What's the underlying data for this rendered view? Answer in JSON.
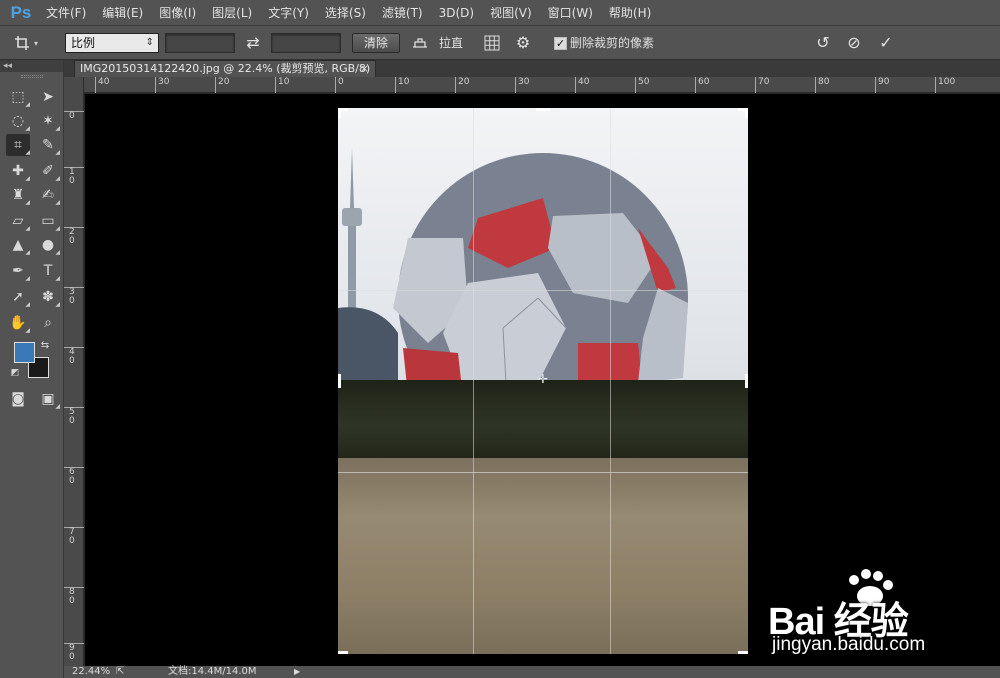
{
  "app": {
    "logo": "Ps"
  },
  "menu": [
    "文件(F)",
    "编辑(E)",
    "图像(I)",
    "图层(L)",
    "文字(Y)",
    "选择(S)",
    "滤镜(T)",
    "3D(D)",
    "视图(V)",
    "窗口(W)",
    "帮助(H)"
  ],
  "options": {
    "ratio_select": "比例",
    "clear_button": "清除",
    "straighten_label": "拉直",
    "delete_cropped_checked": true,
    "delete_cropped_label": "删除裁剪的像素"
  },
  "document": {
    "tab_title": "IMG20150314122420.jpg @ 22.4% (裁剪预览, RGB/8)",
    "close_symbol": "×"
  },
  "rulers": {
    "horizontal": [
      "40",
      "30",
      "20",
      "10",
      "0",
      "10",
      "20",
      "30",
      "40",
      "50",
      "60",
      "70",
      "80",
      "90",
      "100"
    ],
    "vertical": [
      "0",
      "1\n0",
      "2\n0",
      "3\n0",
      "4\n0",
      "5\n0",
      "6\n0",
      "7\n0",
      "8\n0",
      "9\n0"
    ]
  },
  "status": {
    "zoom": "22.44%",
    "doc_info": "文档:14.4M/14.0M"
  },
  "colors": {
    "foreground": "#3b78b8",
    "background": "#1a1a1a",
    "accent": "#4ba3e6"
  },
  "watermark": {
    "brand": "Bai 经验",
    "url": "jingyan.baidu.com"
  }
}
